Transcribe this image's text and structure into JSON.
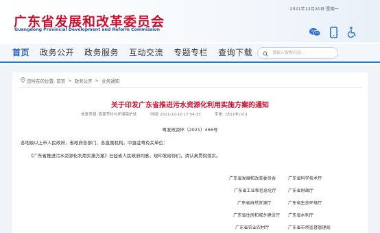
{
  "header": {
    "date": "2021年12月20日 星期一",
    "brand_cn": "广东省发展和改革委员会",
    "brand_en": "Guangdong Provincial Development and Reform Commission",
    "icons": [
      "wechat-icon",
      "mobile-icon",
      "accessibility-icon"
    ],
    "accent_color": "#c8102e",
    "brand_blue": "#1f4fa0"
  },
  "nav": {
    "items": [
      "首页",
      "政务公开",
      "政务服务",
      "互动交流",
      "专题专栏",
      "查询下载"
    ],
    "active": "首页",
    "search_placeholder": "请输入搜索内容..."
  },
  "breadcrumb": {
    "prefix": "您所在的位置:",
    "items": [
      "首页",
      "政务公开",
      "业务通知"
    ],
    "separator": ">"
  },
  "article": {
    "title": "关于印发广东省推进污水资源化利用实施方案的通知",
    "source_label": "信息来源:",
    "source": "资源节约与环境保护处",
    "time_label": "时间:",
    "time": "2021-12-10 17:54:33",
    "font_size_label": "字体:",
    "font_sizes": [
      "[大]",
      "[中]",
      "[小]"
    ],
    "doc_number": "粤发改资环〔2021〕466号",
    "addressee": "各地级以上市人民政府，省政府各部门、各直属机构，中直驻粤有关单位：",
    "paragraph": "《广东省推进污水资源化利用实施方案》已经省人民政府同意，现印发给你们，请认真贯彻落实。",
    "signers": [
      "广东省发展和改革委员会",
      "广东省科学技术厅",
      "广东省工业和信息化厅",
      "广东省财政厅",
      "广东省自然资源厅",
      "广东省生态环境厅",
      "广东省住房和城乡建设厅",
      "广东省水利厅",
      "广东省农业农村厅",
      "广东省市场监督管理局"
    ]
  }
}
